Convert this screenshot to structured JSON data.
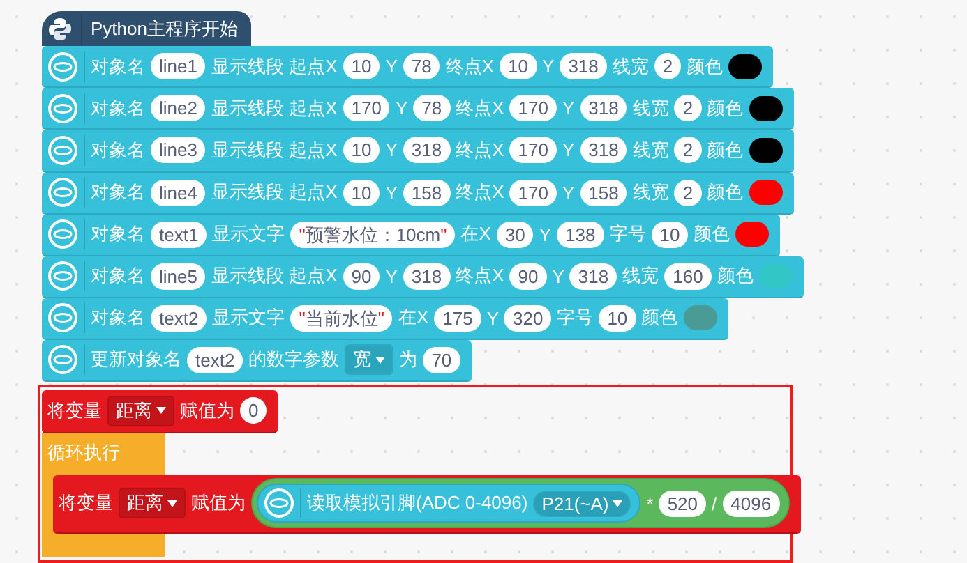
{
  "program": {
    "title": "Python主程序开始",
    "blocks": [
      {
        "kind": "unihiker",
        "parts": [
          {
            "kind": "label",
            "text": "对象名"
          },
          {
            "kind": "value",
            "text": "line1"
          },
          {
            "kind": "label",
            "text": "显示线段 起点X"
          },
          {
            "kind": "value",
            "text": "10"
          },
          {
            "kind": "label",
            "text": "Y"
          },
          {
            "kind": "value",
            "text": "78"
          },
          {
            "kind": "label",
            "text": "终点X"
          },
          {
            "kind": "value",
            "text": "10"
          },
          {
            "kind": "label",
            "text": "Y"
          },
          {
            "kind": "value",
            "text": "318"
          },
          {
            "kind": "label",
            "text": "线宽"
          },
          {
            "kind": "value",
            "text": "2"
          },
          {
            "kind": "label",
            "text": "颜色"
          },
          {
            "kind": "color",
            "color": "#000000"
          }
        ]
      },
      {
        "kind": "unihiker",
        "parts": [
          {
            "kind": "label",
            "text": "对象名"
          },
          {
            "kind": "value",
            "text": "line2"
          },
          {
            "kind": "label",
            "text": "显示线段 起点X"
          },
          {
            "kind": "value",
            "text": "170"
          },
          {
            "kind": "label",
            "text": "Y"
          },
          {
            "kind": "value",
            "text": "78"
          },
          {
            "kind": "label",
            "text": "终点X"
          },
          {
            "kind": "value",
            "text": "170"
          },
          {
            "kind": "label",
            "text": "Y"
          },
          {
            "kind": "value",
            "text": "318"
          },
          {
            "kind": "label",
            "text": "线宽"
          },
          {
            "kind": "value",
            "text": "2"
          },
          {
            "kind": "label",
            "text": "颜色"
          },
          {
            "kind": "color",
            "color": "#000000"
          }
        ]
      },
      {
        "kind": "unihiker",
        "parts": [
          {
            "kind": "label",
            "text": "对象名"
          },
          {
            "kind": "value",
            "text": "line3"
          },
          {
            "kind": "label",
            "text": "显示线段 起点X"
          },
          {
            "kind": "value",
            "text": "10"
          },
          {
            "kind": "label",
            "text": "Y"
          },
          {
            "kind": "value",
            "text": "318"
          },
          {
            "kind": "label",
            "text": "终点X"
          },
          {
            "kind": "value",
            "text": "170"
          },
          {
            "kind": "label",
            "text": "Y"
          },
          {
            "kind": "value",
            "text": "318"
          },
          {
            "kind": "label",
            "text": "线宽"
          },
          {
            "kind": "value",
            "text": "2"
          },
          {
            "kind": "label",
            "text": "颜色"
          },
          {
            "kind": "color",
            "color": "#000000"
          }
        ]
      },
      {
        "kind": "unihiker",
        "parts": [
          {
            "kind": "label",
            "text": "对象名"
          },
          {
            "kind": "value",
            "text": "line4"
          },
          {
            "kind": "label",
            "text": "显示线段 起点X"
          },
          {
            "kind": "value",
            "text": "10"
          },
          {
            "kind": "label",
            "text": "Y"
          },
          {
            "kind": "value",
            "text": "158"
          },
          {
            "kind": "label",
            "text": "终点X"
          },
          {
            "kind": "value",
            "text": "170"
          },
          {
            "kind": "label",
            "text": "Y"
          },
          {
            "kind": "value",
            "text": "158"
          },
          {
            "kind": "label",
            "text": "线宽"
          },
          {
            "kind": "value",
            "text": "2"
          },
          {
            "kind": "label",
            "text": "颜色"
          },
          {
            "kind": "color",
            "color": "#ff0000"
          }
        ]
      },
      {
        "kind": "unihiker",
        "parts": [
          {
            "kind": "label",
            "text": "对象名"
          },
          {
            "kind": "value",
            "text": "text1"
          },
          {
            "kind": "label",
            "text": "显示文字"
          },
          {
            "kind": "string",
            "quote": "\"",
            "text": "预警水位：10cm"
          },
          {
            "kind": "label",
            "text": "在X"
          },
          {
            "kind": "value",
            "text": "30"
          },
          {
            "kind": "label",
            "text": "Y"
          },
          {
            "kind": "value",
            "text": "138"
          },
          {
            "kind": "label",
            "text": "字号"
          },
          {
            "kind": "value",
            "text": "10"
          },
          {
            "kind": "label",
            "text": "颜色"
          },
          {
            "kind": "color",
            "color": "#ff0000"
          }
        ]
      },
      {
        "kind": "unihiker",
        "parts": [
          {
            "kind": "label",
            "text": "对象名"
          },
          {
            "kind": "value",
            "text": "line5"
          },
          {
            "kind": "label",
            "text": "显示线段 起点X"
          },
          {
            "kind": "value",
            "text": "90"
          },
          {
            "kind": "label",
            "text": "Y"
          },
          {
            "kind": "value",
            "text": "318"
          },
          {
            "kind": "label",
            "text": "终点X"
          },
          {
            "kind": "value",
            "text": "90"
          },
          {
            "kind": "label",
            "text": "Y"
          },
          {
            "kind": "value",
            "text": "318"
          },
          {
            "kind": "label",
            "text": "线宽"
          },
          {
            "kind": "value",
            "text": "160"
          },
          {
            "kind": "label",
            "text": "颜色"
          },
          {
            "kind": "color",
            "color": "#33c6c6"
          }
        ]
      },
      {
        "kind": "unihiker",
        "parts": [
          {
            "kind": "label",
            "text": "对象名"
          },
          {
            "kind": "value",
            "text": "text2"
          },
          {
            "kind": "label",
            "text": "显示文字"
          },
          {
            "kind": "string",
            "quote": "\"",
            "text": "当前水位"
          },
          {
            "kind": "label",
            "text": "在X"
          },
          {
            "kind": "value",
            "text": "175"
          },
          {
            "kind": "label",
            "text": "Y"
          },
          {
            "kind": "value",
            "text": "320"
          },
          {
            "kind": "label",
            "text": "字号"
          },
          {
            "kind": "value",
            "text": "10"
          },
          {
            "kind": "label",
            "text": "颜色"
          },
          {
            "kind": "color",
            "color": "#4a9a96"
          }
        ]
      },
      {
        "kind": "unihiker",
        "parts": [
          {
            "kind": "label",
            "text": "更新对象名"
          },
          {
            "kind": "value",
            "text": "text2"
          },
          {
            "kind": "label",
            "text": "的数字参数"
          },
          {
            "kind": "dropdown",
            "text": "宽"
          },
          {
            "kind": "label",
            "text": "为"
          },
          {
            "kind": "value",
            "text": "70"
          }
        ]
      }
    ]
  },
  "highlight": {
    "init": {
      "kind": "variable",
      "parts": [
        {
          "kind": "label",
          "text": "将变量"
        },
        {
          "kind": "dropdown",
          "text": "距离"
        },
        {
          "kind": "label",
          "text": "赋值为"
        },
        {
          "kind": "value",
          "text": "0"
        }
      ]
    },
    "loop": {
      "label": "循环执行",
      "body": {
        "kind": "variable",
        "parts": [
          {
            "kind": "label",
            "text": "将变量"
          },
          {
            "kind": "dropdown",
            "text": "距离"
          },
          {
            "kind": "label",
            "text": "赋值为"
          },
          {
            "kind": "math",
            "parts": [
              {
                "kind": "reporter",
                "parts": [
                  {
                    "kind": "label",
                    "text": "读取模拟引脚(ADC 0-4096)"
                  },
                  {
                    "kind": "dropdown",
                    "text": "P21(~A)"
                  }
                ]
              },
              {
                "kind": "label",
                "text": "*"
              },
              {
                "kind": "value",
                "text": "520"
              },
              {
                "kind": "label",
                "text": "/"
              },
              {
                "kind": "value",
                "text": "4096"
              }
            ]
          }
        ]
      }
    }
  }
}
